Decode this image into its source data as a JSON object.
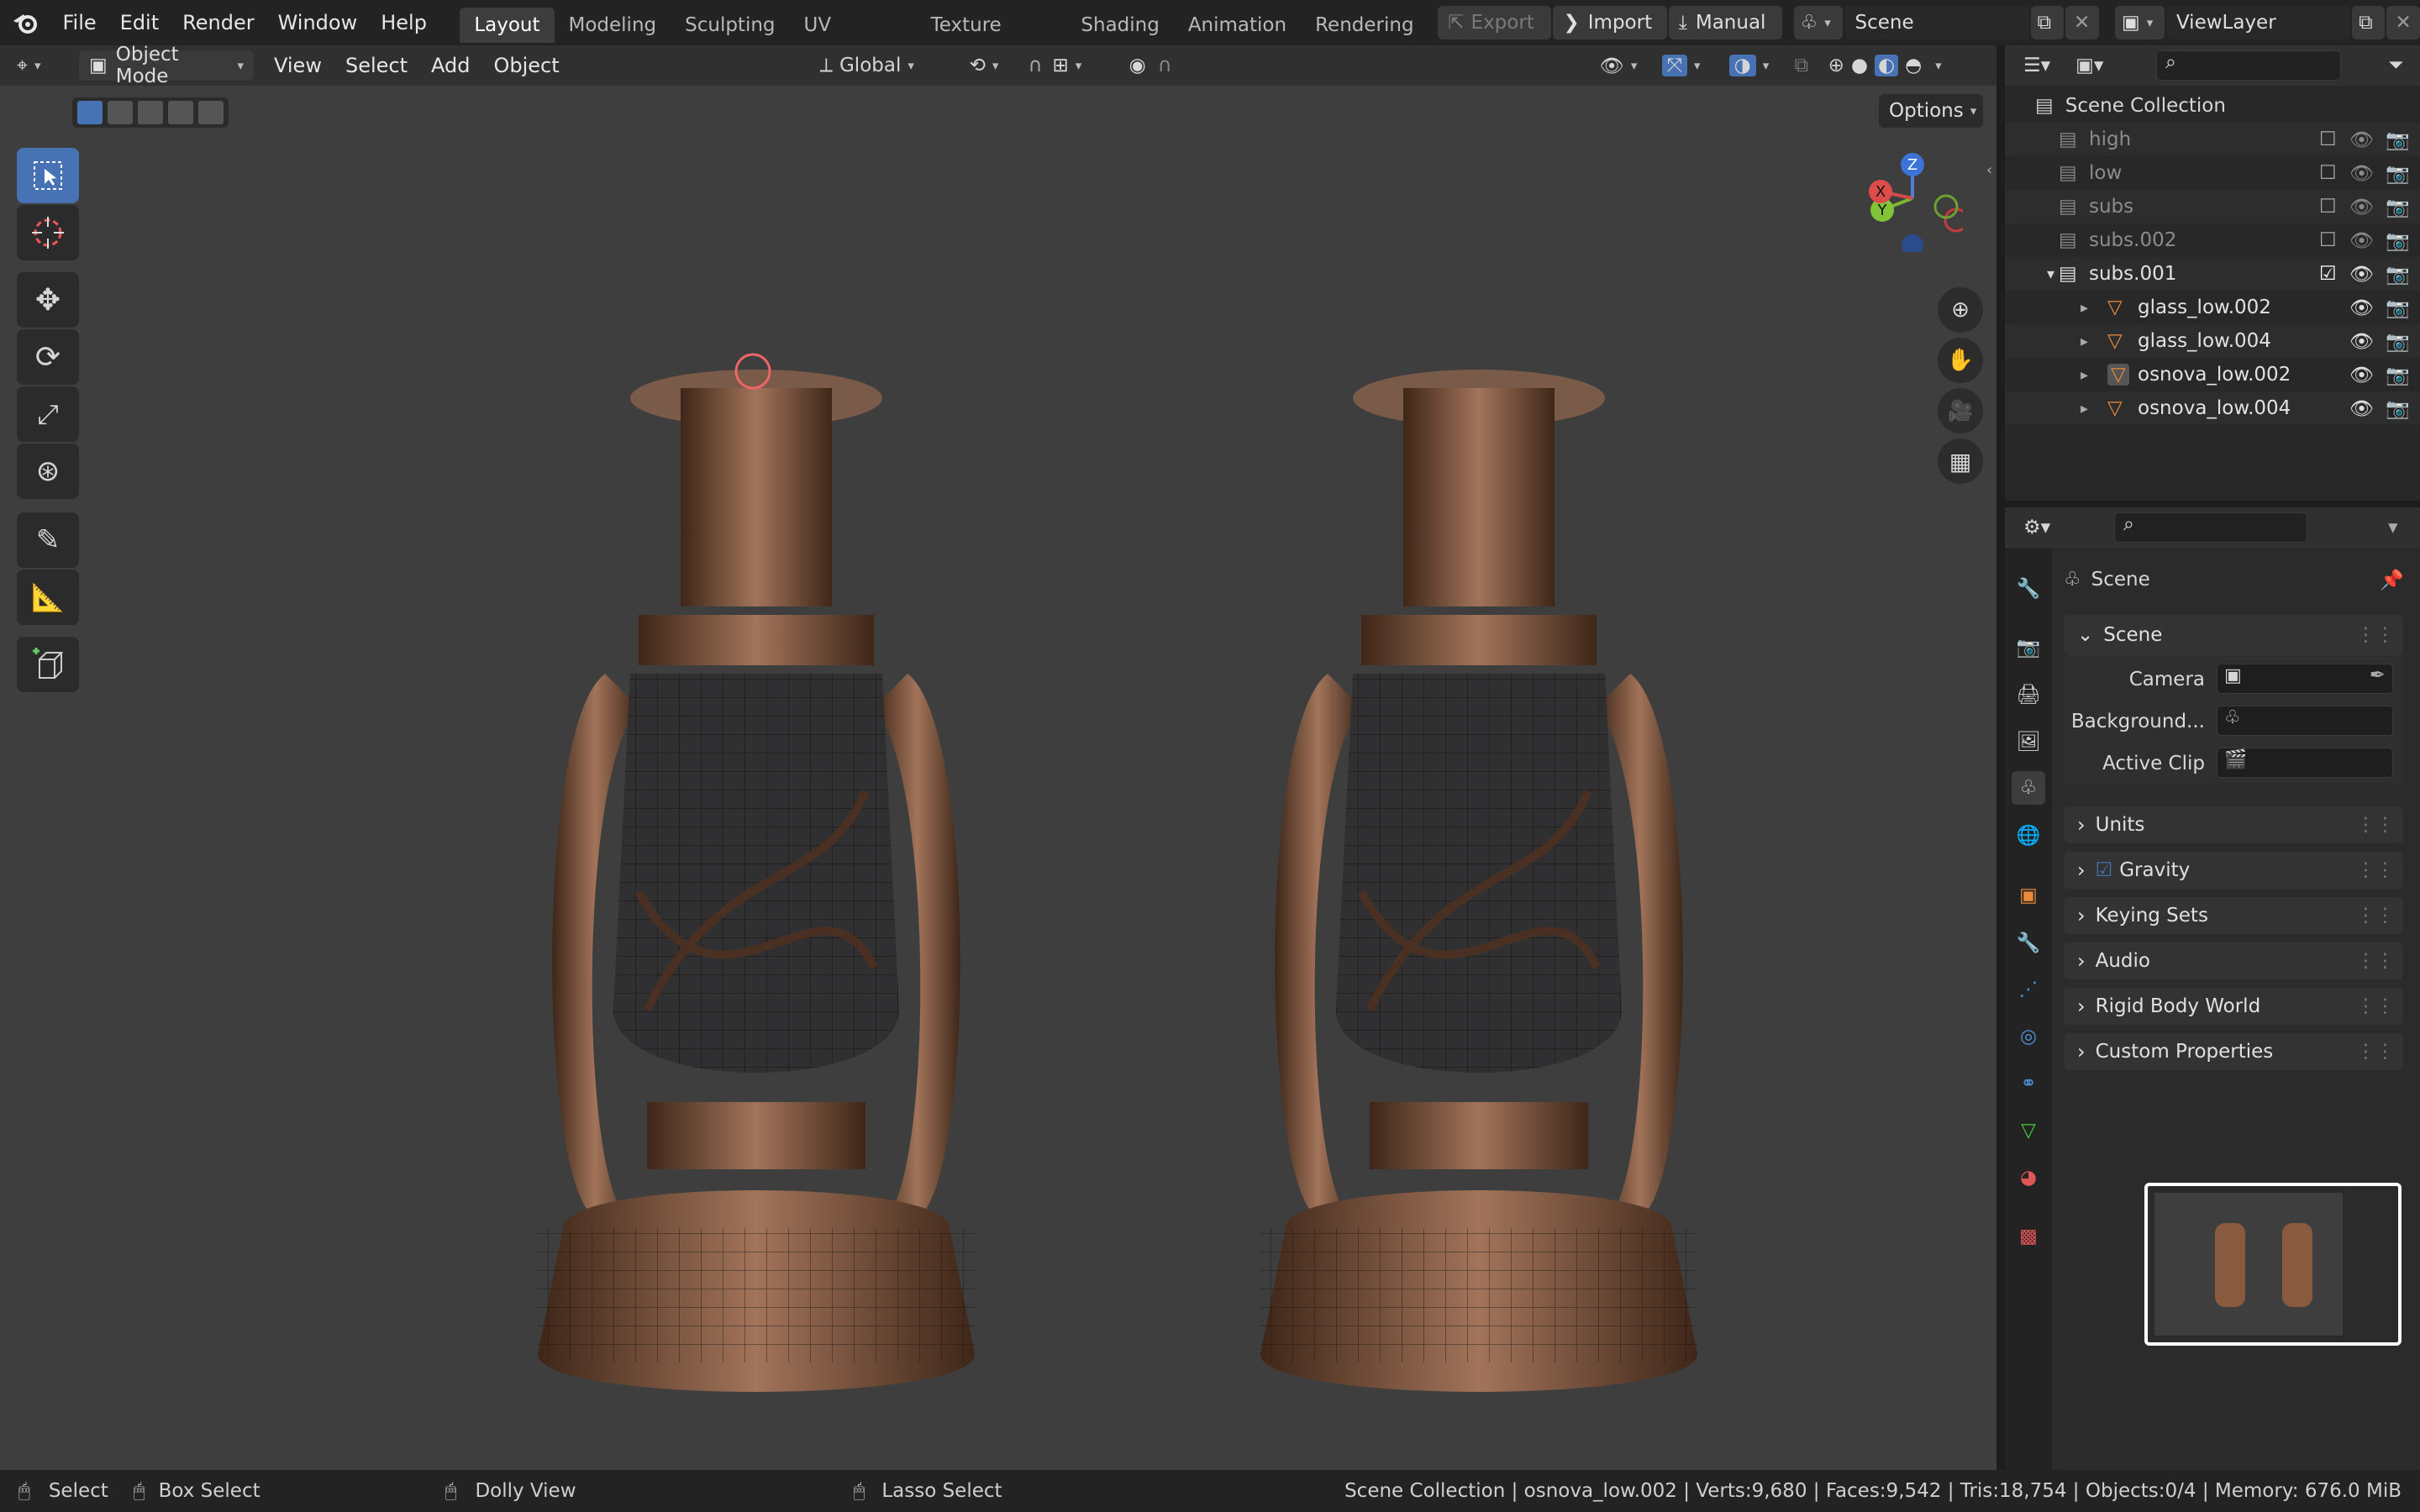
{
  "menu": [
    "File",
    "Edit",
    "Render",
    "Window",
    "Help"
  ],
  "workspaces": [
    "Layout",
    "Modeling",
    "Sculpting",
    "UV Editing",
    "Texture Paint",
    "Shading",
    "Animation",
    "Rendering"
  ],
  "header_right": {
    "export": "Export",
    "import": "Import",
    "manual": "Manual",
    "scene": "Scene",
    "view_layer": "ViewLayer"
  },
  "viewport_header": {
    "mode": "Object Mode",
    "view": "View",
    "select": "Select",
    "add": "Add",
    "object": "Object",
    "orientation": "Global",
    "options": "Options"
  },
  "gizmo": {
    "z": "Z",
    "y": "Y",
    "x": "X"
  },
  "outliner": {
    "root": "Scene Collection",
    "rows": [
      {
        "name": "high",
        "dim": true,
        "checked": false
      },
      {
        "name": "low",
        "dim": true,
        "checked": false
      },
      {
        "name": "subs",
        "dim": true,
        "checked": false
      },
      {
        "name": "subs.002",
        "dim": true,
        "checked": false
      },
      {
        "name": "subs.001",
        "dim": false,
        "checked": true
      },
      {
        "name": "glass_low.002",
        "obj": true
      },
      {
        "name": "glass_low.004",
        "obj": true
      },
      {
        "name": "osnova_low.002",
        "obj": true,
        "active": true
      },
      {
        "name": "osnova_low.004",
        "obj": true
      }
    ]
  },
  "properties": {
    "context": "Scene",
    "section": "Scene",
    "fields": [
      {
        "label": "Camera"
      },
      {
        "label": "Background..."
      },
      {
        "label": "Active Clip"
      }
    ],
    "panels": [
      "Units",
      "Gravity",
      "Keying Sets",
      "Audio",
      "Rigid Body World",
      "Custom Properties"
    ],
    "gravity_checked": true
  },
  "status": {
    "select": "Select",
    "box_select": "Box Select",
    "dolly": "Dolly View",
    "lasso": "Lasso Select",
    "info": "Scene Collection | osnova_low.002 | Verts:9,680 | Faces:9,542 | Tris:18,754 | Objects:0/4 | Memory: 676.0 MiB"
  },
  "colors": {
    "accent": "#4772b3",
    "object_orange": "#e88a3a",
    "viewport": "#3e3e3e",
    "lantern": "#8a5a3e"
  }
}
